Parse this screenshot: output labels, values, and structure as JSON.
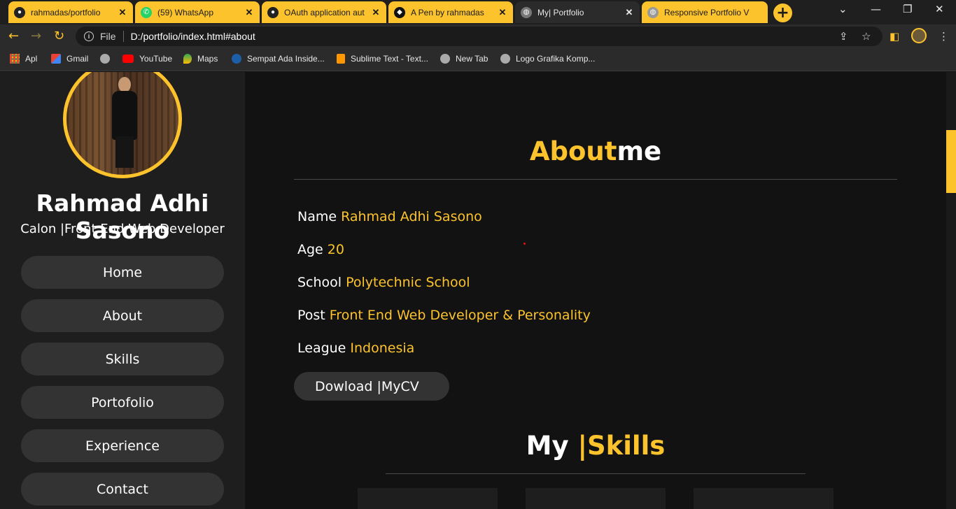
{
  "browser": {
    "tabs": [
      {
        "title": "rahmadas/portfolio",
        "icon": "github-icon",
        "active": false
      },
      {
        "title": "(59) WhatsApp",
        "icon": "whatsapp-icon",
        "active": false
      },
      {
        "title": "OAuth application aut",
        "icon": "github-icon",
        "active": false
      },
      {
        "title": "A Pen by rahmadas",
        "icon": "codepen-icon",
        "active": false
      },
      {
        "title": "My| Portfolio",
        "icon": "globe-icon",
        "active": true
      },
      {
        "title": "Responsive Portfolio V",
        "icon": "globe-icon",
        "active": false
      }
    ],
    "address": {
      "scheme": "File",
      "url": "D:/portfolio/index.html#about"
    },
    "bookmarks": [
      {
        "label": "Apl",
        "icon": "apps-grid-icon"
      },
      {
        "label": "Gmail",
        "icon": "gmail-icon"
      },
      {
        "label": "",
        "icon": "globe-icon"
      },
      {
        "label": "YouTube",
        "icon": "youtube-icon"
      },
      {
        "label": "Maps",
        "icon": "maps-pin-icon"
      },
      {
        "label": "Sempat Ada Inside...",
        "icon": "tribun-icon"
      },
      {
        "label": "Sublime Text - Text...",
        "icon": "sublime-icon"
      },
      {
        "label": "New Tab",
        "icon": "globe-icon"
      },
      {
        "label": "Logo Grafika Komp...",
        "icon": "globe-icon"
      }
    ]
  },
  "sidebar": {
    "name": "Rahmad Adhi Sasono",
    "role": "Calon |Front End Web Developer",
    "nav": [
      "Home",
      "About",
      "Skills",
      "Portofolio",
      "Experience",
      "Contact"
    ]
  },
  "about": {
    "title_accent": "About",
    "title_rest": "me",
    "rows": [
      {
        "label": "Name",
        "value": "Rahmad Adhi Sasono"
      },
      {
        "label": "Age",
        "value": "20"
      },
      {
        "label": "School",
        "value": "Polytechnic School"
      },
      {
        "label": "Post",
        "value": "Front End Web Developer & Personality"
      },
      {
        "label": "League",
        "value": "Indonesia"
      }
    ],
    "cv_button": "Dowload |MyCV"
  },
  "skills": {
    "title_plain": "My ",
    "title_accent": "|Skills"
  },
  "colors": {
    "accent": "#fcc32d",
    "background": "#121212",
    "sidebar": "#1e1e1e",
    "button": "#333333"
  }
}
